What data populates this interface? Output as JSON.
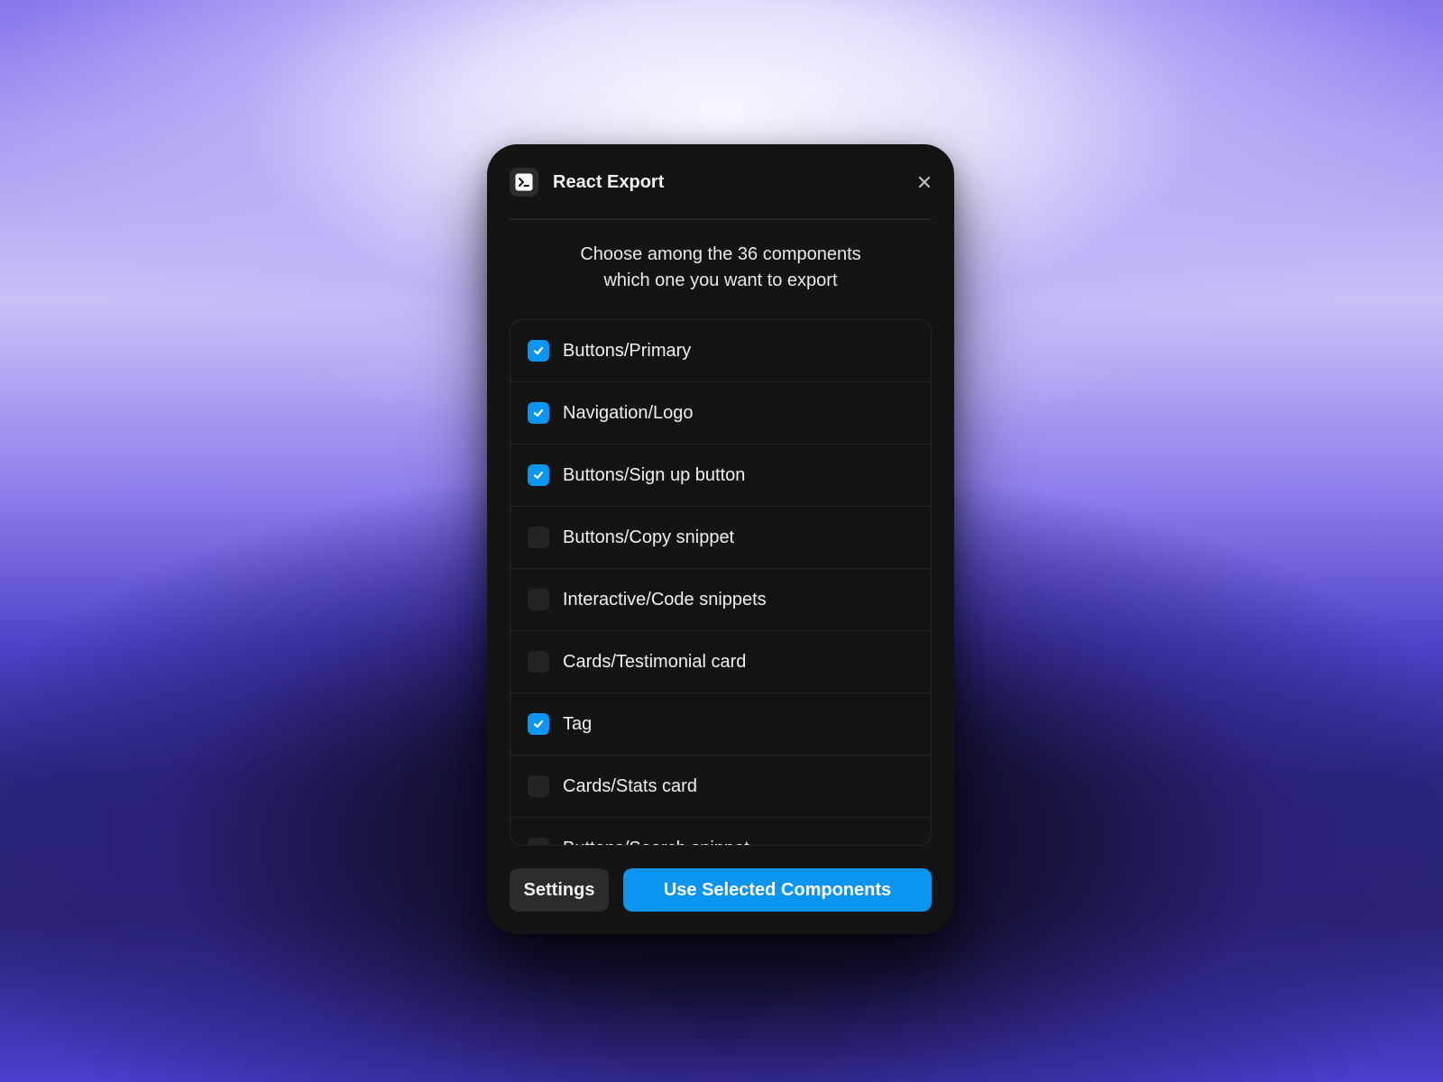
{
  "dialog": {
    "title": "React Export",
    "icon": "terminal-icon",
    "close_icon": "close-icon",
    "subtitle_line1": "Choose among the 36 components",
    "subtitle_line2": "which one you want to export"
  },
  "components": [
    {
      "label": "Buttons/Primary",
      "checked": true
    },
    {
      "label": "Navigation/Logo",
      "checked": true
    },
    {
      "label": "Buttons/Sign up button",
      "checked": true
    },
    {
      "label": "Buttons/Copy snippet",
      "checked": false
    },
    {
      "label": "Interactive/Code snippets",
      "checked": false
    },
    {
      "label": "Cards/Testimonial card",
      "checked": false
    },
    {
      "label": "Tag",
      "checked": true
    },
    {
      "label": "Cards/Stats card",
      "checked": false
    },
    {
      "label": "Buttons/Search snippet",
      "checked": false
    }
  ],
  "footer": {
    "settings_label": "Settings",
    "primary_label": "Use Selected Components"
  },
  "colors": {
    "accent": "#0a95f0",
    "panel": "#141414",
    "checkbox_unchecked": "#242424"
  }
}
